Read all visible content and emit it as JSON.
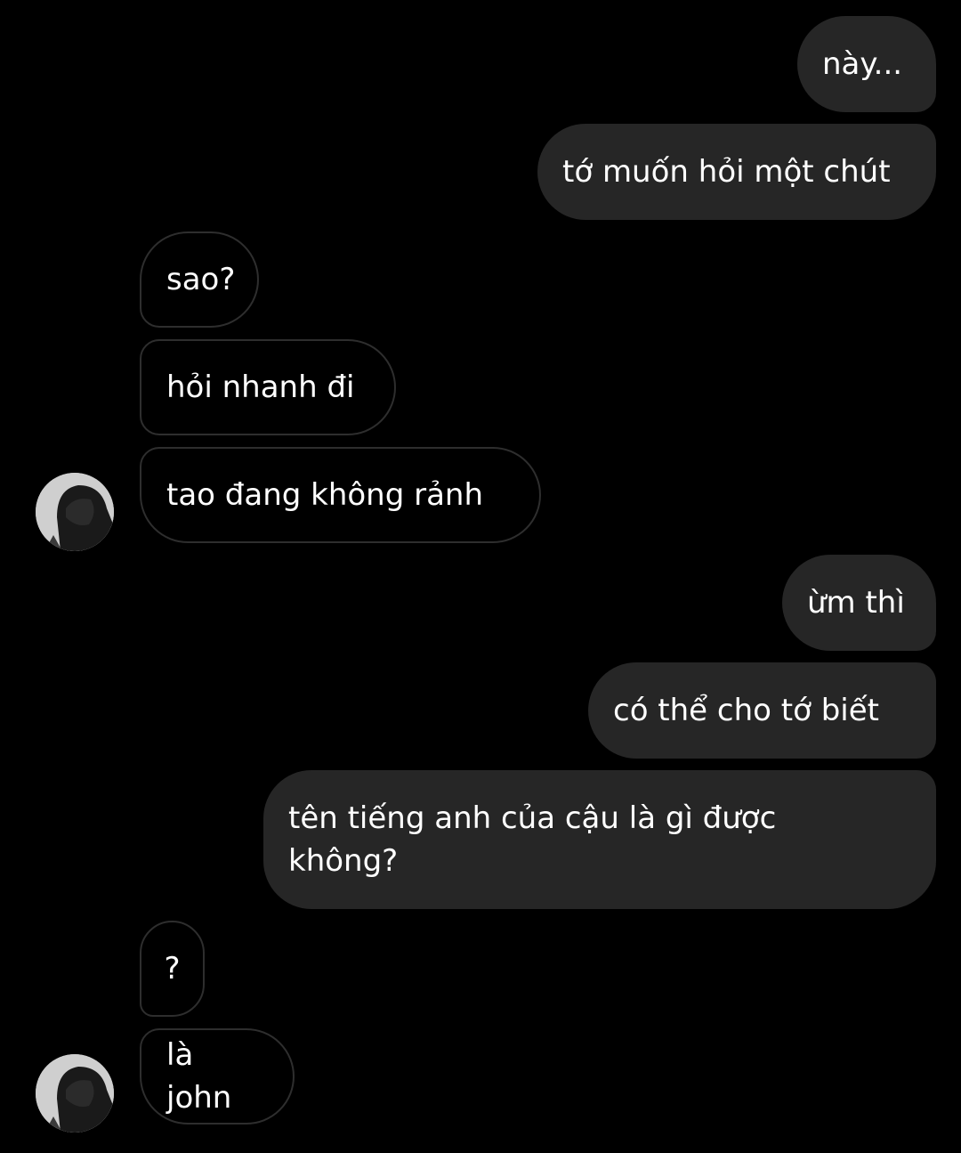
{
  "messages": [
    {
      "side": "sent",
      "text": "này..."
    },
    {
      "side": "sent",
      "text": "tớ muốn hỏi một chút"
    },
    {
      "side": "received",
      "text": "sao?"
    },
    {
      "side": "received",
      "text": "hỏi nhanh đi"
    },
    {
      "side": "received",
      "text": "tao đang không rảnh"
    },
    {
      "side": "sent",
      "text": "ừm thì"
    },
    {
      "side": "sent",
      "text": "có thể cho tớ biết"
    },
    {
      "side": "sent",
      "text": "tên tiếng anh của cậu là gì được\nkhông?"
    },
    {
      "side": "received",
      "text": "?"
    },
    {
      "side": "received",
      "text": "là john"
    }
  ],
  "contact": {
    "avatar_icon": "hooded-figure-avatar"
  },
  "colors": {
    "background": "#000000",
    "sent_bubble": "#262626",
    "received_border": "#2e2e2e",
    "text": "#ffffff"
  }
}
